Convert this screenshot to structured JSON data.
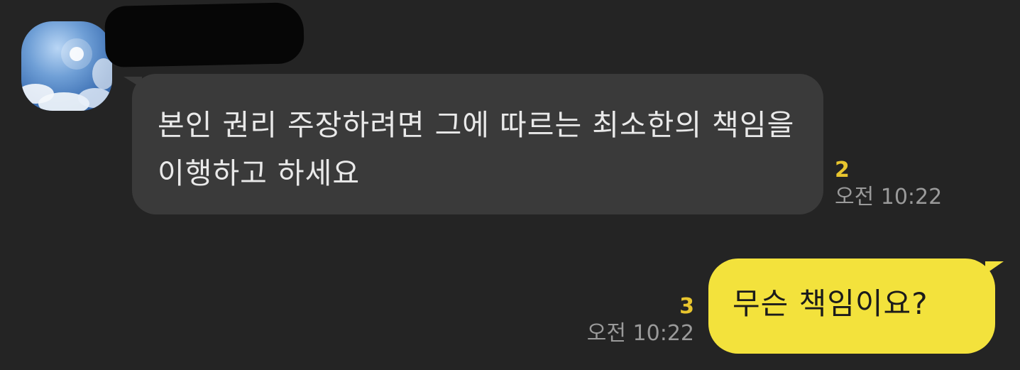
{
  "conversation": {
    "incoming": {
      "avatar_icon": "sky-photo-avatar",
      "message": "본인 권리 주장하려면 그에 따르는 최소한의 책임을 이행하고 하세요",
      "unread_count": "2",
      "time": "오전 10:22"
    },
    "outgoing": {
      "message": "무슨 책임이요?",
      "unread_count": "3",
      "time": "오전 10:22"
    }
  },
  "colors": {
    "background": "#242424",
    "incoming_bubble": "#3a3a3a",
    "outgoing_bubble": "#f3e23c",
    "unread_count": "#e8c52e",
    "timestamp": "#9a9a9a"
  }
}
